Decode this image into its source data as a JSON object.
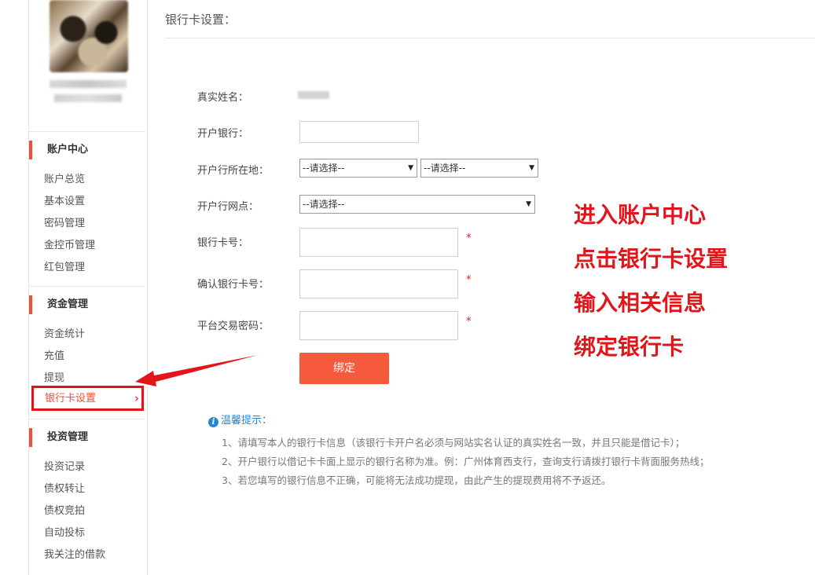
{
  "sidebar": {
    "user_name": "██████████",
    "user_sub": "██ ████",
    "groups": [
      {
        "title": "账户中心",
        "items": [
          "账户总览",
          "基本设置",
          "密码管理",
          "金控币管理",
          "红包管理"
        ]
      },
      {
        "title": "资金管理",
        "items": [
          "资金统计",
          "充值",
          "提现"
        ],
        "active": "银行卡设置"
      },
      {
        "title": "投资管理",
        "items": [
          "投资记录",
          "债权转让",
          "债权竞拍",
          "自动投标",
          "我关注的借款"
        ]
      }
    ],
    "active_chevron": "›"
  },
  "main": {
    "title": "银行卡设置：",
    "form": {
      "real_name_label": "真实姓名：",
      "real_name_value": "███",
      "bank_label": "开户银行：",
      "bank_value": "",
      "location_label": "开户行所在地：",
      "province_select": "--请选择--",
      "city_select": "--请选择--",
      "branch_label": "开户行网点：",
      "branch_select": "--请选择--",
      "card_label": "银行卡号：",
      "confirm_card_label": "确认银行卡号：",
      "password_label": "平台交易密码：",
      "required_mark": "*",
      "submit_label": "绑定"
    },
    "tips": {
      "title": "温馨提示：",
      "items": [
        "1、请填写本人的银行卡信息（该银行卡开户名必须与网站实名认证的真实姓名一致，并且只能是借记卡）；",
        "2、开户银行以借记卡卡面上显示的银行名称为准。例：广州体育西支行，查询支行请拨打银行卡背面服务热线；",
        "3、若您填写的银行信息不正确，可能将无法成功提现，由此产生的提现费用将不予返还。"
      ]
    }
  },
  "annotations": [
    "进入账户中心",
    "点击银行卡设置",
    "输入相关信息",
    "绑定银行卡"
  ],
  "colors": {
    "accent": "#f04e36",
    "button": "#f55a3c",
    "annotation": "#e3151b",
    "tip": "#2d84cc"
  }
}
